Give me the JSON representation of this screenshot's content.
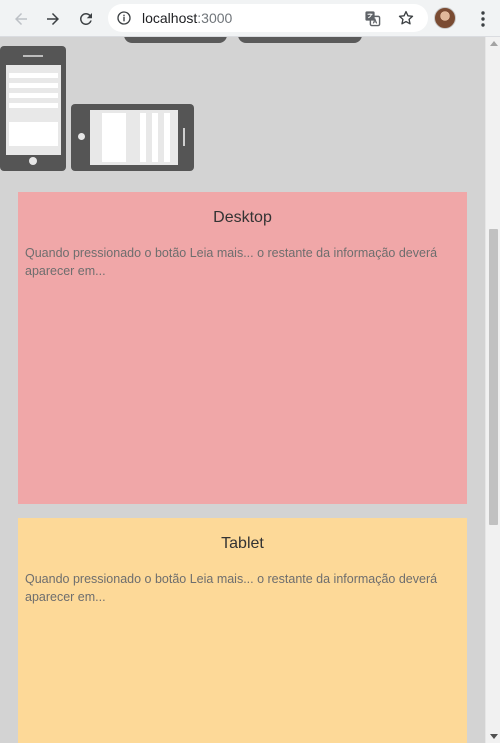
{
  "browser": {
    "url_host": "localhost",
    "url_port": ":3000"
  },
  "cards": {
    "desktop": {
      "title": "Desktop",
      "text": "Quando pressionado o botão Leia mais... o restante da informação deverá aparecer em...",
      "color": "#f0a7a8"
    },
    "tablet": {
      "title": "Tablet",
      "text": "Quando pressionado o botão Leia mais... o restante da informação deverá aparecer em...",
      "color": "#fdd998"
    }
  },
  "colors": {
    "page_background": "#d3d3d3",
    "device_gray": "#555555"
  },
  "icons": {
    "back": "arrow-left-icon",
    "forward": "arrow-right-icon",
    "reload": "reload-icon",
    "info": "info-icon",
    "translate": "translate-icon",
    "bookmark": "star-icon",
    "menu": "kebab-menu-icon",
    "phone": "phone-illustration-icon",
    "tablet": "tablet-illustration-icon"
  }
}
